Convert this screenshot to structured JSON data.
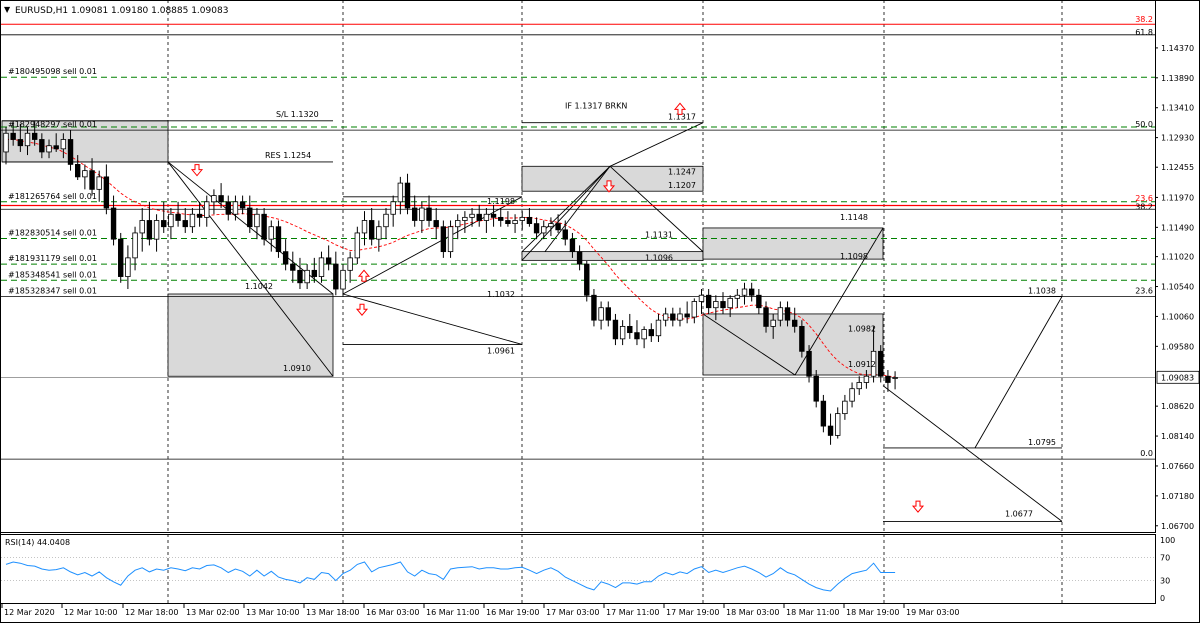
{
  "header": {
    "title": "EURUSD,H1  1.09081 1.09180 1.08885 1.09083",
    "triangle": "▼"
  },
  "price_axis": {
    "ticks": [
      "1.14370",
      "1.13890",
      "1.13410",
      "1.12930",
      "1.12455",
      "1.11970",
      "1.11490",
      "1.11020",
      "1.10540",
      "1.10060",
      "1.09580",
      "1.09083",
      "1.08620",
      "1.08140",
      "1.07660",
      "1.07180",
      "1.06700"
    ],
    "current": "1.09083"
  },
  "chart_data": {
    "type": "candlestick",
    "symbol": "EURUSD",
    "timeframe": "H1",
    "ylim": [
      1.066,
      1.1485
    ],
    "time_labels": [
      "12 Mar 2020",
      "12 Mar 10:00",
      "12 Mar 18:00",
      "13 Mar 02:00",
      "13 Mar 10:00",
      "13 Mar 18:00",
      "16 Mar 03:00",
      "16 Mar 11:00",
      "16 Mar 19:00",
      "17 Mar 03:00",
      "17 Mar 11:00",
      "17 Mar 19:00",
      "18 Mar 03:00",
      "18 Mar 11:00",
      "18 Mar 19:00",
      "19 Mar 03:00"
    ],
    "candles": [
      [
        1.127,
        1.131,
        1.125,
        1.13
      ],
      [
        1.13,
        1.132,
        1.128,
        1.129
      ],
      [
        1.129,
        1.1315,
        1.127,
        1.128
      ],
      [
        1.128,
        1.131,
        1.1265,
        1.13
      ],
      [
        1.13,
        1.132,
        1.128,
        1.129
      ],
      [
        1.129,
        1.13,
        1.126,
        1.127
      ],
      [
        1.127,
        1.129,
        1.126,
        1.128
      ],
      [
        1.128,
        1.13,
        1.127,
        1.1275
      ],
      [
        1.1275,
        1.13,
        1.126,
        1.129
      ],
      [
        1.129,
        1.1305,
        1.124,
        1.125
      ],
      [
        1.125,
        1.1265,
        1.1225,
        1.123
      ],
      [
        1.123,
        1.125,
        1.121,
        1.124
      ],
      [
        1.124,
        1.126,
        1.12,
        1.121
      ],
      [
        1.121,
        1.124,
        1.119,
        1.123
      ],
      [
        1.123,
        1.125,
        1.117,
        1.118
      ],
      [
        1.118,
        1.12,
        1.112,
        1.113
      ],
      [
        1.113,
        1.114,
        1.106,
        1.107
      ],
      [
        1.107,
        1.112,
        1.105,
        1.11
      ],
      [
        1.11,
        1.115,
        1.108,
        1.114
      ],
      [
        1.114,
        1.118,
        1.111,
        1.116
      ],
      [
        1.116,
        1.119,
        1.112,
        1.113
      ],
      [
        1.113,
        1.117,
        1.111,
        1.116
      ],
      [
        1.116,
        1.119,
        1.114,
        1.115
      ],
      [
        1.115,
        1.118,
        1.113,
        1.117
      ],
      [
        1.117,
        1.119,
        1.115,
        1.116
      ],
      [
        1.116,
        1.118,
        1.114,
        1.115
      ],
      [
        1.115,
        1.118,
        1.114,
        1.117
      ],
      [
        1.117,
        1.119,
        1.115,
        1.1165
      ],
      [
        1.1165,
        1.12,
        1.115,
        1.119
      ],
      [
        1.119,
        1.121,
        1.117,
        1.12
      ],
      [
        1.12,
        1.122,
        1.118,
        1.119
      ],
      [
        1.119,
        1.12,
        1.116,
        1.117
      ],
      [
        1.117,
        1.12,
        1.116,
        1.119
      ],
      [
        1.119,
        1.12,
        1.117,
        1.118
      ],
      [
        1.118,
        1.12,
        1.114,
        1.115
      ],
      [
        1.115,
        1.118,
        1.113,
        1.117
      ],
      [
        1.117,
        1.118,
        1.112,
        1.113
      ],
      [
        1.113,
        1.116,
        1.111,
        1.115
      ],
      [
        1.115,
        1.116,
        1.11,
        1.111
      ],
      [
        1.111,
        1.113,
        1.108,
        1.109
      ],
      [
        1.109,
        1.111,
        1.106,
        1.108
      ],
      [
        1.108,
        1.11,
        1.105,
        1.106
      ],
      [
        1.106,
        1.109,
        1.105,
        1.108
      ],
      [
        1.108,
        1.11,
        1.106,
        1.107
      ],
      [
        1.107,
        1.111,
        1.106,
        1.11
      ],
      [
        1.11,
        1.112,
        1.108,
        1.109
      ],
      [
        1.109,
        1.111,
        1.104,
        1.105
      ],
      [
        1.105,
        1.109,
        1.104,
        1.108
      ],
      [
        1.108,
        1.111,
        1.106,
        1.11
      ],
      [
        1.11,
        1.115,
        1.109,
        1.114
      ],
      [
        1.114,
        1.1175,
        1.112,
        1.116
      ],
      [
        1.116,
        1.118,
        1.112,
        1.113
      ],
      [
        1.113,
        1.116,
        1.111,
        1.115
      ],
      [
        1.115,
        1.118,
        1.113,
        1.117
      ],
      [
        1.117,
        1.12,
        1.115,
        1.119
      ],
      [
        1.119,
        1.123,
        1.117,
        1.122
      ],
      [
        1.122,
        1.1235,
        1.117,
        1.118
      ],
      [
        1.118,
        1.12,
        1.115,
        1.116
      ],
      [
        1.116,
        1.119,
        1.114,
        1.118
      ],
      [
        1.118,
        1.12,
        1.115,
        1.116
      ],
      [
        1.116,
        1.118,
        1.113,
        1.115
      ],
      [
        1.115,
        1.116,
        1.11,
        1.111
      ],
      [
        1.111,
        1.116,
        1.11,
        1.115
      ],
      [
        1.115,
        1.117,
        1.113,
        1.116
      ],
      [
        1.116,
        1.1175,
        1.114,
        1.1165
      ],
      [
        1.1165,
        1.118,
        1.115,
        1.117
      ],
      [
        1.117,
        1.1185,
        1.115,
        1.116
      ],
      [
        1.116,
        1.118,
        1.114,
        1.117
      ],
      [
        1.117,
        1.1185,
        1.115,
        1.1165
      ],
      [
        1.1165,
        1.118,
        1.115,
        1.116
      ],
      [
        1.116,
        1.1175,
        1.115,
        1.1155
      ],
      [
        1.1155,
        1.117,
        1.114,
        1.116
      ],
      [
        1.116,
        1.1175,
        1.1145,
        1.1165
      ],
      [
        1.1165,
        1.118,
        1.115,
        1.1155
      ],
      [
        1.1155,
        1.1165,
        1.113,
        1.114
      ],
      [
        1.114,
        1.116,
        1.113,
        1.115
      ],
      [
        1.115,
        1.1165,
        1.1135,
        1.1155
      ],
      [
        1.1155,
        1.117,
        1.114,
        1.1145
      ],
      [
        1.1145,
        1.116,
        1.112,
        1.113
      ],
      [
        1.113,
        1.114,
        1.11,
        1.111
      ],
      [
        1.111,
        1.112,
        1.108,
        1.109
      ],
      [
        1.109,
        1.1095,
        1.103,
        1.104
      ],
      [
        1.104,
        1.105,
        1.099,
        1.1
      ],
      [
        1.1,
        1.103,
        1.0985,
        1.102
      ],
      [
        1.102,
        1.103,
        1.099,
        1.1
      ],
      [
        1.1,
        1.101,
        1.096,
        1.097
      ],
      [
        1.097,
        1.1,
        1.096,
        1.099
      ],
      [
        1.099,
        1.101,
        1.097,
        1.098
      ],
      [
        1.098,
        1.1,
        1.096,
        1.097
      ],
      [
        1.097,
        1.099,
        1.0955,
        1.0985
      ],
      [
        1.0985,
        1.0995,
        1.0965,
        1.0975
      ],
      [
        1.0975,
        1.101,
        1.0965,
        1.1
      ],
      [
        1.1,
        1.102,
        1.099,
        1.101
      ],
      [
        1.101,
        1.102,
        1.099,
        1.1
      ],
      [
        1.1,
        1.102,
        1.099,
        1.101
      ],
      [
        1.101,
        1.103,
        1.0995,
        1.1005
      ],
      [
        1.1005,
        1.1035,
        1.0995,
        1.103
      ],
      [
        1.103,
        1.105,
        1.101,
        1.104
      ],
      [
        1.104,
        1.105,
        1.101,
        1.102
      ],
      [
        1.102,
        1.104,
        1.1,
        1.103
      ],
      [
        1.103,
        1.1045,
        1.101,
        1.102
      ],
      [
        1.102,
        1.104,
        1.1005,
        1.1035
      ],
      [
        1.1035,
        1.105,
        1.102,
        1.104
      ],
      [
        1.104,
        1.106,
        1.1025,
        1.105
      ],
      [
        1.105,
        1.106,
        1.103,
        1.104
      ],
      [
        1.104,
        1.105,
        1.101,
        1.102
      ],
      [
        1.102,
        1.103,
        1.098,
        1.099
      ],
      [
        1.099,
        1.101,
        1.097,
        1.1
      ],
      [
        1.1,
        1.103,
        1.099,
        1.102
      ],
      [
        1.102,
        1.103,
        1.099,
        1.1
      ],
      [
        1.1,
        1.102,
        1.098,
        1.099
      ],
      [
        1.099,
        1.1,
        1.094,
        1.095
      ],
      [
        1.095,
        1.096,
        1.09,
        1.091
      ],
      [
        1.091,
        1.092,
        1.086,
        1.087
      ],
      [
        1.087,
        1.088,
        1.082,
        1.083
      ],
      [
        1.083,
        1.085,
        1.08,
        1.0815
      ],
      [
        1.0815,
        1.086,
        1.081,
        1.085
      ],
      [
        1.085,
        1.088,
        1.084,
        1.087
      ],
      [
        1.087,
        1.09,
        1.086,
        1.089
      ],
      [
        1.089,
        1.091,
        1.088,
        1.09
      ],
      [
        1.09,
        1.092,
        1.089,
        1.091
      ],
      [
        1.091,
        1.099,
        1.09,
        1.095
      ],
      [
        1.095,
        1.096,
        1.09,
        1.091
      ],
      [
        1.091,
        1.092,
        1.0885,
        1.09
      ],
      [
        1.0908,
        1.0918,
        1.0889,
        1.0908
      ]
    ],
    "ma": [
      [
        1.129,
        1.129,
        1.1288,
        1.1286,
        1.1284,
        1.1281,
        1.1278,
        1.1275,
        1.127,
        1.1263,
        1.1256,
        1.1248,
        1.1241,
        1.1233,
        1.1224,
        1.1214,
        1.1204,
        1.1196,
        1.119,
        1.1185,
        1.118,
        1.1177,
        1.1175,
        1.1173,
        1.1172,
        1.117,
        1.1169,
        1.1168,
        1.1168,
        1.1169,
        1.117,
        1.117,
        1.117,
        1.1171,
        1.117,
        1.1169,
        1.1167,
        1.1165,
        1.1162,
        1.1158,
        1.1153,
        1.1148,
        1.1142,
        1.1137,
        1.1132,
        1.1127,
        1.1121,
        1.1116,
        1.1112,
        1.1112,
        1.1114,
        1.1116,
        1.1118,
        1.1121,
        1.1125,
        1.1131,
        1.1136,
        1.114,
        1.1144,
        1.1147,
        1.1148,
        1.1148,
        1.115,
        1.1152,
        1.1154,
        1.1157,
        1.1159,
        1.1161,
        1.1163,
        1.1164,
        1.1164,
        1.1164,
        1.1165,
        1.1165,
        1.1163,
        1.1161,
        1.1159,
        1.1157,
        1.1153,
        1.1147,
        1.1139,
        1.1128,
        1.1114,
        1.1101,
        1.1088,
        1.1073,
        1.1061,
        1.1049,
        1.1038,
        1.1027,
        1.1017,
        1.101,
        1.1006,
        1.1002,
        1.1002,
        1.1002,
        1.1004,
        1.1008,
        1.1011,
        1.1014,
        1.1016,
        1.1018,
        1.102,
        1.1022,
        1.1024,
        1.1024,
        1.1022,
        1.1018,
        1.1016,
        1.1014,
        1.101,
        1.1003,
        1.0992,
        1.0978,
        1.0962,
        1.0947,
        1.0935,
        1.0926,
        1.0919,
        1.0914,
        1.0912,
        1.0913,
        1.0913,
        1.091,
        1.0909
      ]
    ],
    "rsi": {
      "label": "RSI(14) 44.0408",
      "levels": [
        100,
        70,
        30,
        0
      ],
      "values": [
        58,
        62,
        60,
        56,
        55,
        50,
        48,
        49,
        52,
        45,
        40,
        44,
        38,
        45,
        35,
        28,
        22,
        38,
        48,
        52,
        45,
        50,
        48,
        52,
        50,
        47,
        52,
        50,
        56,
        57,
        52,
        44,
        50,
        46,
        38,
        48,
        38,
        46,
        36,
        32,
        30,
        26,
        35,
        32,
        44,
        42,
        30,
        42,
        48,
        58,
        62,
        45,
        52,
        55,
        58,
        62,
        45,
        38,
        48,
        42,
        40,
        32,
        50,
        52,
        53,
        54,
        50,
        52,
        52,
        50,
        50,
        52,
        53,
        48,
        42,
        48,
        52,
        46,
        36,
        30,
        24,
        18,
        14,
        28,
        24,
        18,
        26,
        26,
        24,
        28,
        28,
        38,
        44,
        40,
        45,
        42,
        50,
        54,
        44,
        48,
        44,
        48,
        52,
        55,
        50,
        44,
        36,
        42,
        52,
        44,
        40,
        32,
        24,
        18,
        14,
        12,
        24,
        34,
        42,
        45,
        48,
        60,
        44,
        44,
        44
      ]
    },
    "order_labels": [
      "#180495098 sell 0.01",
      "#181265764 sell 0.01",
      "#182830514 sell 0.01",
      "#181931179 sell 0.01",
      "#185348541 sell 0.01",
      "#185328347 sell 0.01"
    ],
    "annotations": {
      "sl": "S/L 1.1320",
      "res": "RES 1.1254",
      "if_brkn": "IF 1.1317 BRKN",
      "p_1317": "1.1317",
      "p_1247": "1.1247",
      "p_1207": "1.1207",
      "p_1198": "1.1198",
      "p_1148": "1.1148",
      "p_1131": "1.1131",
      "p_1096": "1.1096",
      "p_1098": "1.1098",
      "p_1042": "1.1042",
      "p_1038": "1.1038",
      "p_1032": "1.1032",
      "p_0961": "1.0961",
      "p_0982": "1.0982",
      "p_0912": "1.0912",
      "p_0910": "1.0910",
      "p_0795": "1.0795",
      "p_0677": "1.0677",
      "overlap_left": "#182948297 sell 0.01",
      "fib_382": "38.2",
      "fib_618": "61.8",
      "fib_50": "50.0",
      "fib_236a": "23.6",
      "fib_382b": "38.2",
      "fib_236b": "23.6",
      "fib_00": "0.0"
    },
    "colors": {
      "bull_candle": "#ffffff",
      "bear_candle": "#000000",
      "ma": "#ff0000",
      "rsi": "#1e90ff",
      "order_line": "#008000",
      "fib_red": "#ff0000",
      "box_fill": "#d9d9d9",
      "arrow": "#ff0000"
    }
  }
}
